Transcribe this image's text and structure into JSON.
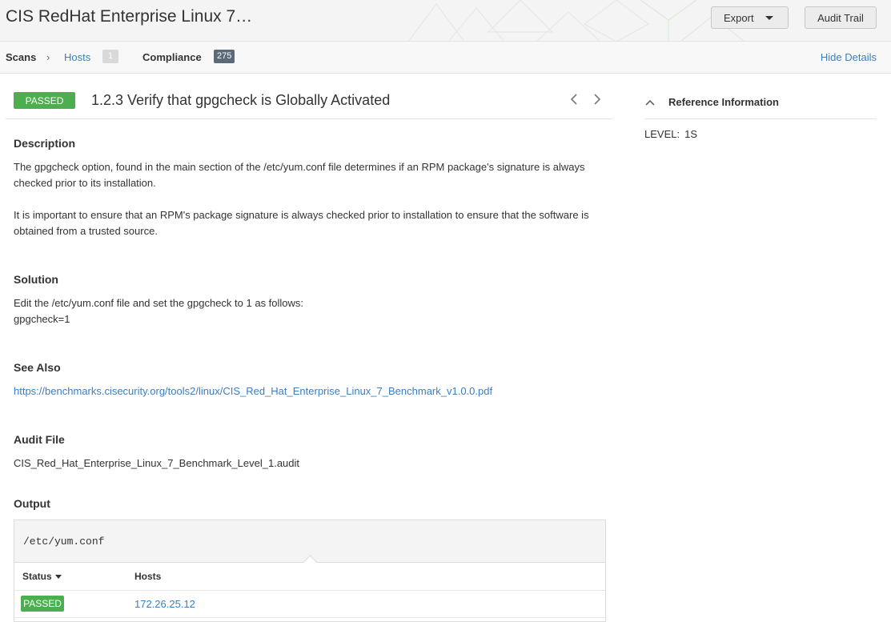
{
  "header": {
    "title": "CIS RedHat Enterprise Linux 7…",
    "export_label": "Export",
    "audit_trail_label": "Audit Trail"
  },
  "breadcrumb": {
    "scans": "Scans",
    "separator": "›",
    "hosts": "Hosts",
    "hosts_count": "1",
    "compliance": "Compliance",
    "compliance_count": "275",
    "hide_details": "Hide Details"
  },
  "check": {
    "status": "PASSED",
    "title": "1.2.3 Verify that gpgcheck is Globally Activated",
    "prev_icon": "chevron-left-icon",
    "next_icon": "chevron-right-icon"
  },
  "description": {
    "heading": "Description",
    "p1": "The gpgcheck option, found in the main section of the /etc/yum.conf file determines if an RPM package's signature is always checked prior to its installation.",
    "p2": "It is important to ensure that an RPM's package signature is always checked prior to installation to ensure that the software is obtained from a trusted source."
  },
  "solution": {
    "heading": "Solution",
    "line1": "Edit the /etc/yum.conf file and set the gpgcheck to 1 as follows:",
    "line2": "gpgcheck=1"
  },
  "see_also": {
    "heading": "See Also",
    "link": "https://benchmarks.cisecurity.org/tools2/linux/CIS_Red_Hat_Enterprise_Linux_7_Benchmark_v1.0.0.pdf"
  },
  "audit_file": {
    "heading": "Audit File",
    "value": "CIS_Red_Hat_Enterprise_Linux_7_Benchmark_Level_1.audit"
  },
  "output": {
    "heading": "Output",
    "code": "/etc/yum.conf",
    "columns": [
      "Status",
      "Hosts"
    ],
    "rows": [
      {
        "status": "PASSED",
        "host": "172.26.25.12"
      }
    ]
  },
  "reference": {
    "title": "Reference Information",
    "level_label": "LEVEL:",
    "level_value": "1S"
  },
  "colors": {
    "passed": "#4cae4f",
    "link": "#3a7fc1"
  }
}
